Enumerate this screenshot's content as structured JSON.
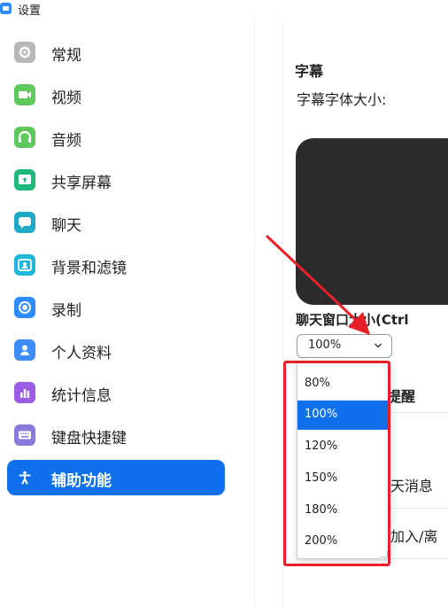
{
  "window": {
    "title": "设置"
  },
  "sidebar": {
    "items": [
      {
        "label": "常规",
        "icon": "gear-icon",
        "color": "#b8b8b8"
      },
      {
        "label": "视频",
        "icon": "video-camera-icon",
        "color": "#5fc95f"
      },
      {
        "label": "音频",
        "icon": "headphones-icon",
        "color": "#5fc95f"
      },
      {
        "label": "共享屏幕",
        "icon": "share-screen-icon",
        "color": "#1fb87a"
      },
      {
        "label": "聊天",
        "icon": "chat-bubble-icon",
        "color": "#1fa9c6"
      },
      {
        "label": "背景和滤镜",
        "icon": "background-person-icon",
        "color": "#20b6d8"
      },
      {
        "label": "录制",
        "icon": "record-icon",
        "color": "#2d8cff"
      },
      {
        "label": "个人资料",
        "icon": "profile-person-icon",
        "color": "#3c8cf5"
      },
      {
        "label": "统计信息",
        "icon": "statistics-bars-icon",
        "color": "#9b5de5"
      },
      {
        "label": "键盘快捷键",
        "icon": "keyboard-icon",
        "color": "#8a79d8"
      },
      {
        "label": "辅助功能",
        "icon": "accessibility-person-icon",
        "color": "#0e71eb"
      }
    ],
    "active_index": 10
  },
  "main": {
    "section_title": "字幕",
    "caption_font_size_label": "字幕字体大小:",
    "chat_window_size_label": "聊天窗口大小(Ctrl",
    "chat_window_size_value": "100%",
    "reminder_partial": "提醒",
    "message_partial": "天消息",
    "join_leave_partial": "加入/离"
  },
  "dropdown": {
    "options": [
      "80%",
      "100%",
      "120%",
      "150%",
      "180%",
      "200%"
    ],
    "selected": "100%"
  },
  "annotation": {
    "color": "#e8202a"
  },
  "colors": {
    "accent": "#0e71eb"
  }
}
